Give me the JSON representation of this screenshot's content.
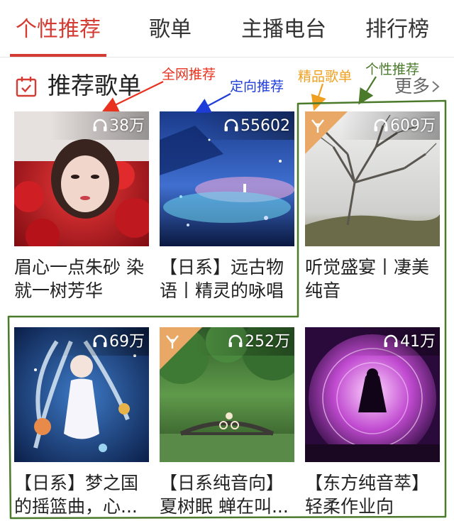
{
  "tabs": [
    {
      "label": "个性推荐",
      "active": true
    },
    {
      "label": "歌单",
      "active": false
    },
    {
      "label": "主播电台",
      "active": false
    },
    {
      "label": "排行榜",
      "active": false
    }
  ],
  "section": {
    "title": "推荐歌单",
    "more": "更多"
  },
  "annotations": {
    "whole_net": "全网推荐",
    "directed": "定向推荐",
    "boutique": "精品歌单",
    "personal": "个性推荐"
  },
  "colors": {
    "accent": "#d43c33",
    "annotation_red": "#e8321e",
    "annotation_blue": "#1e3cd8",
    "annotation_orange": "#f0a020",
    "annotation_green": "#4a7a2a",
    "boutique_badge": "#e9a865"
  },
  "cards": [
    {
      "title_lines": [
        "眉心一点朱砂 染",
        "就一树芳华"
      ],
      "play_count": "38万",
      "boutique": false
    },
    {
      "title_lines": [
        "【日系】远古物",
        "语丨精灵的咏唱"
      ],
      "play_count": "55602",
      "boutique": false
    },
    {
      "title_lines": [
        "听觉盛宴丨凄美",
        "纯音"
      ],
      "play_count": "609万",
      "boutique": true
    },
    {
      "title_lines": [
        "【日系】梦之国",
        "的摇篮曲，心..."
      ],
      "play_count": "69万",
      "boutique": false
    },
    {
      "title_lines": [
        "【日系纯音向】",
        "夏树眠 蝉在叫..."
      ],
      "play_count": "252万",
      "boutique": true
    },
    {
      "title_lines": [
        "【东方纯音萃】",
        "轻柔作业向"
      ],
      "play_count": "41万",
      "boutique": false
    }
  ],
  "icons": {
    "headphones": "headphones-icon",
    "calendar": "calendar-icon",
    "boutique": "boutique-badge-icon",
    "chevron": "chevron-right-icon"
  }
}
